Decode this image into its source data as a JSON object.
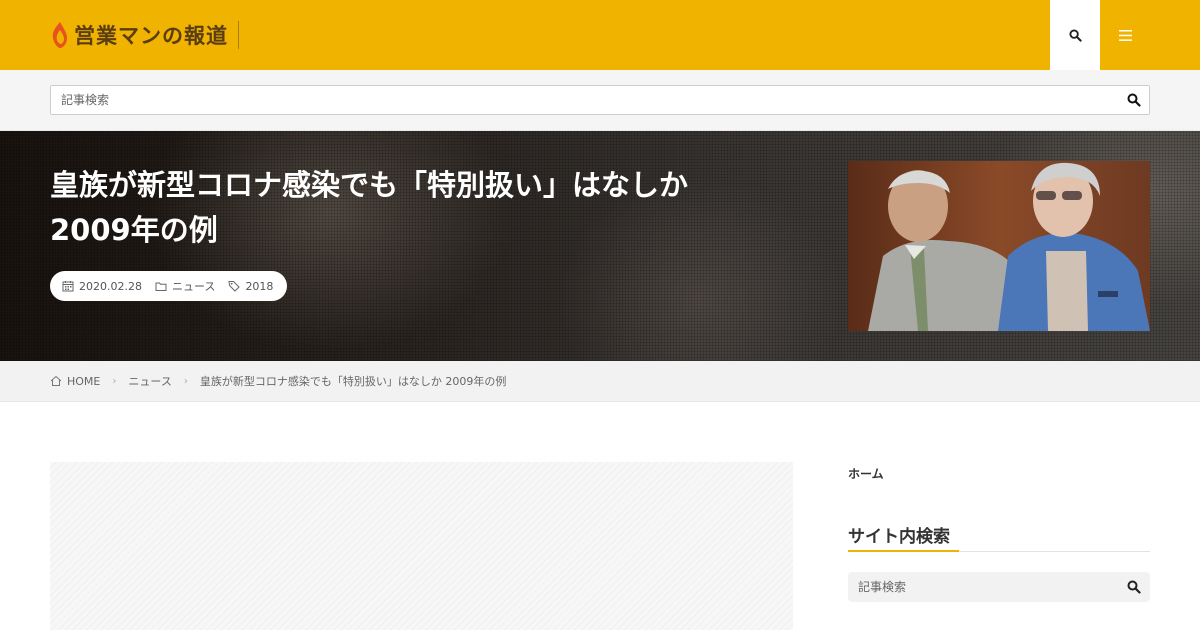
{
  "colors": {
    "accent": "#efb300",
    "hero_bg": "#2c2622",
    "breadcrumb_bg": "#f2f2f2",
    "search_band_bg": "#f5f5f5"
  },
  "header": {
    "logo_text": "営業マンの報道",
    "search_icon": "search-icon",
    "menu_icon": "hamburger-menu-icon"
  },
  "search": {
    "placeholder": "記事検索"
  },
  "hero": {
    "title": "皇族が新型コロナ感染でも「特別扱い」はなしか 2009年の例",
    "date": "2020.02.28",
    "category": "ニュース",
    "tag": "2018"
  },
  "breadcrumb": {
    "items": [
      "HOME",
      "ニュース",
      "皇族が新型コロナ感染でも「特別扱い」はなしか 2009年の例"
    ]
  },
  "sidebar": {
    "home_link": "ホーム",
    "search_heading": "サイト内検索",
    "search_placeholder": "記事検索"
  }
}
